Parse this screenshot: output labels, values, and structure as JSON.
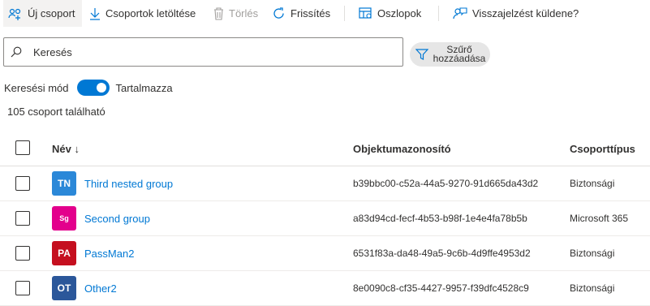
{
  "toolbar": {
    "new_group": "Új csoport",
    "download": "Csoportok letöltése",
    "delete": "Törlés",
    "refresh": "Frissítés",
    "columns": "Oszlopok",
    "feedback": "Visszajelzést küldene?"
  },
  "search": {
    "placeholder": "Keresés",
    "value": ""
  },
  "filter": {
    "label": "Szűrő hozzáadása"
  },
  "search_mode": {
    "label": "Keresési mód",
    "toggle_on": true,
    "toggle_label": "Tartalmazza"
  },
  "result_count": "105 csoport található",
  "table": {
    "headers": {
      "name": "Név ↓",
      "object_id": "Objektumazonosító",
      "group_type": "Csoporttípus"
    },
    "rows": [
      {
        "initials": "TN",
        "color": "#2b88d8",
        "name": "Third nested group",
        "object_id": "b39bbc00-c52a-44a5-9270-91d665da43d2",
        "group_type": "Biztonsági"
      },
      {
        "initials": "Sg",
        "color": "#e3008c",
        "name": "Second group",
        "object_id": "a83d94cd-fecf-4b53-b98f-1e4e4fa78b5b",
        "group_type": "Microsoft 365"
      },
      {
        "initials": "PA",
        "color": "#c50f1f",
        "name": "PassMan2",
        "object_id": "6531f83a-da48-49a5-9c6b-4d9ffe4953d2",
        "group_type": "Biztonsági"
      },
      {
        "initials": "OT",
        "color": "#2b579a",
        "name": "Other2",
        "object_id": "8e0090c8-cf35-4427-9957-f39dfc4528c9",
        "group_type": "Biztonsági"
      }
    ]
  }
}
